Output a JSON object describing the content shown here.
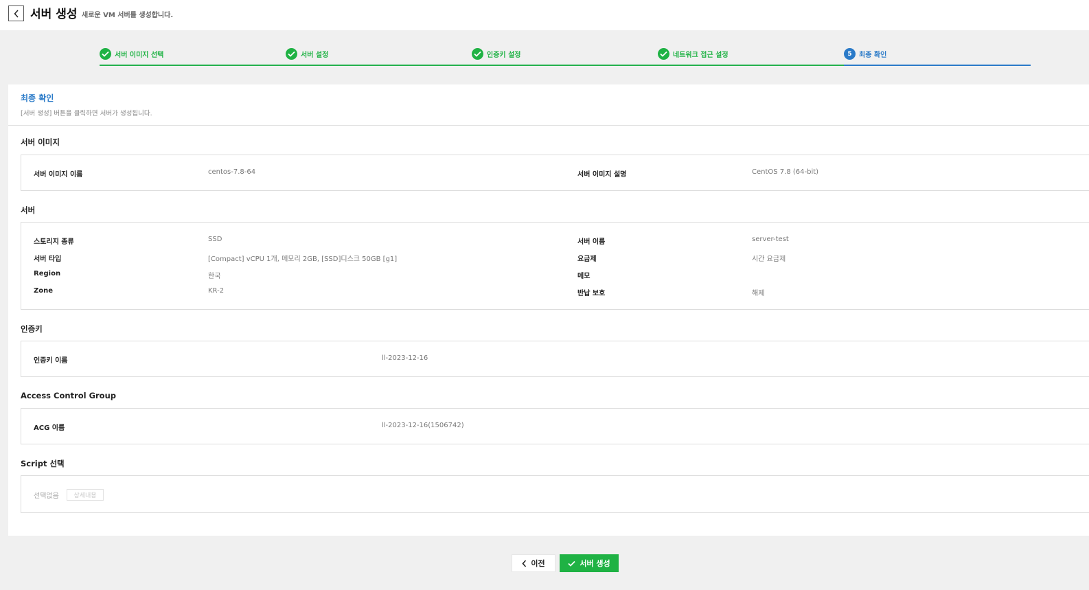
{
  "header": {
    "title": "서버 생성",
    "subtitle": "새로운 VM 서버를 생성합니다."
  },
  "steps": [
    {
      "label": "서버 이미지 선택",
      "state": "done"
    },
    {
      "label": "서버 설정",
      "state": "done"
    },
    {
      "label": "인증키 설정",
      "state": "done"
    },
    {
      "label": "네트워크 접근 설정",
      "state": "done"
    },
    {
      "label": "최종 확인",
      "state": "current",
      "number": "5"
    }
  ],
  "card": {
    "title": "최종 확인",
    "description": "[서버 생성] 버튼을 클릭하면 서버가 생성됩니다."
  },
  "image_section": {
    "title": "서버 이미지",
    "rows": [
      {
        "key": "서버 이미지 이름",
        "value": "centos-7.8-64",
        "key2": "서버 이미지 설명",
        "value2": "CentOS 7.8 (64-bit)"
      }
    ]
  },
  "server_section": {
    "title": "서버",
    "rows": [
      {
        "key": "스토리지 종류",
        "value": "SSD",
        "key2": "서버 이름",
        "value2": "server-test"
      },
      {
        "key": "서버 타입",
        "value": "[Compact] vCPU 1개, 메모리 2GB, [SSD]디스크 50GB [g1]",
        "key2": "요금제",
        "value2": "시간 요금제"
      },
      {
        "key": "Region",
        "value": "한국",
        "key2": "메모",
        "value2": ""
      },
      {
        "key": "Zone",
        "value": "KR-2",
        "key2": "반납 보호",
        "value2": "해제"
      }
    ]
  },
  "authkey_section": {
    "title": "인증키",
    "key": "인증키 이름",
    "value": "ll-2023-12-16"
  },
  "acg_section": {
    "title": "Access Control Group",
    "key": "ACG 이름",
    "value": "ll-2023-12-16(1506742)"
  },
  "script_section": {
    "title": "Script 선택",
    "value": "선택없음",
    "detail_button": "상세내용"
  },
  "footer": {
    "prev_label": "이전",
    "create_label": "서버 생성"
  },
  "colors": {
    "accent_blue": "#2a7ac8",
    "accent_green": "#1fb244",
    "background": "#f0f0f0"
  }
}
